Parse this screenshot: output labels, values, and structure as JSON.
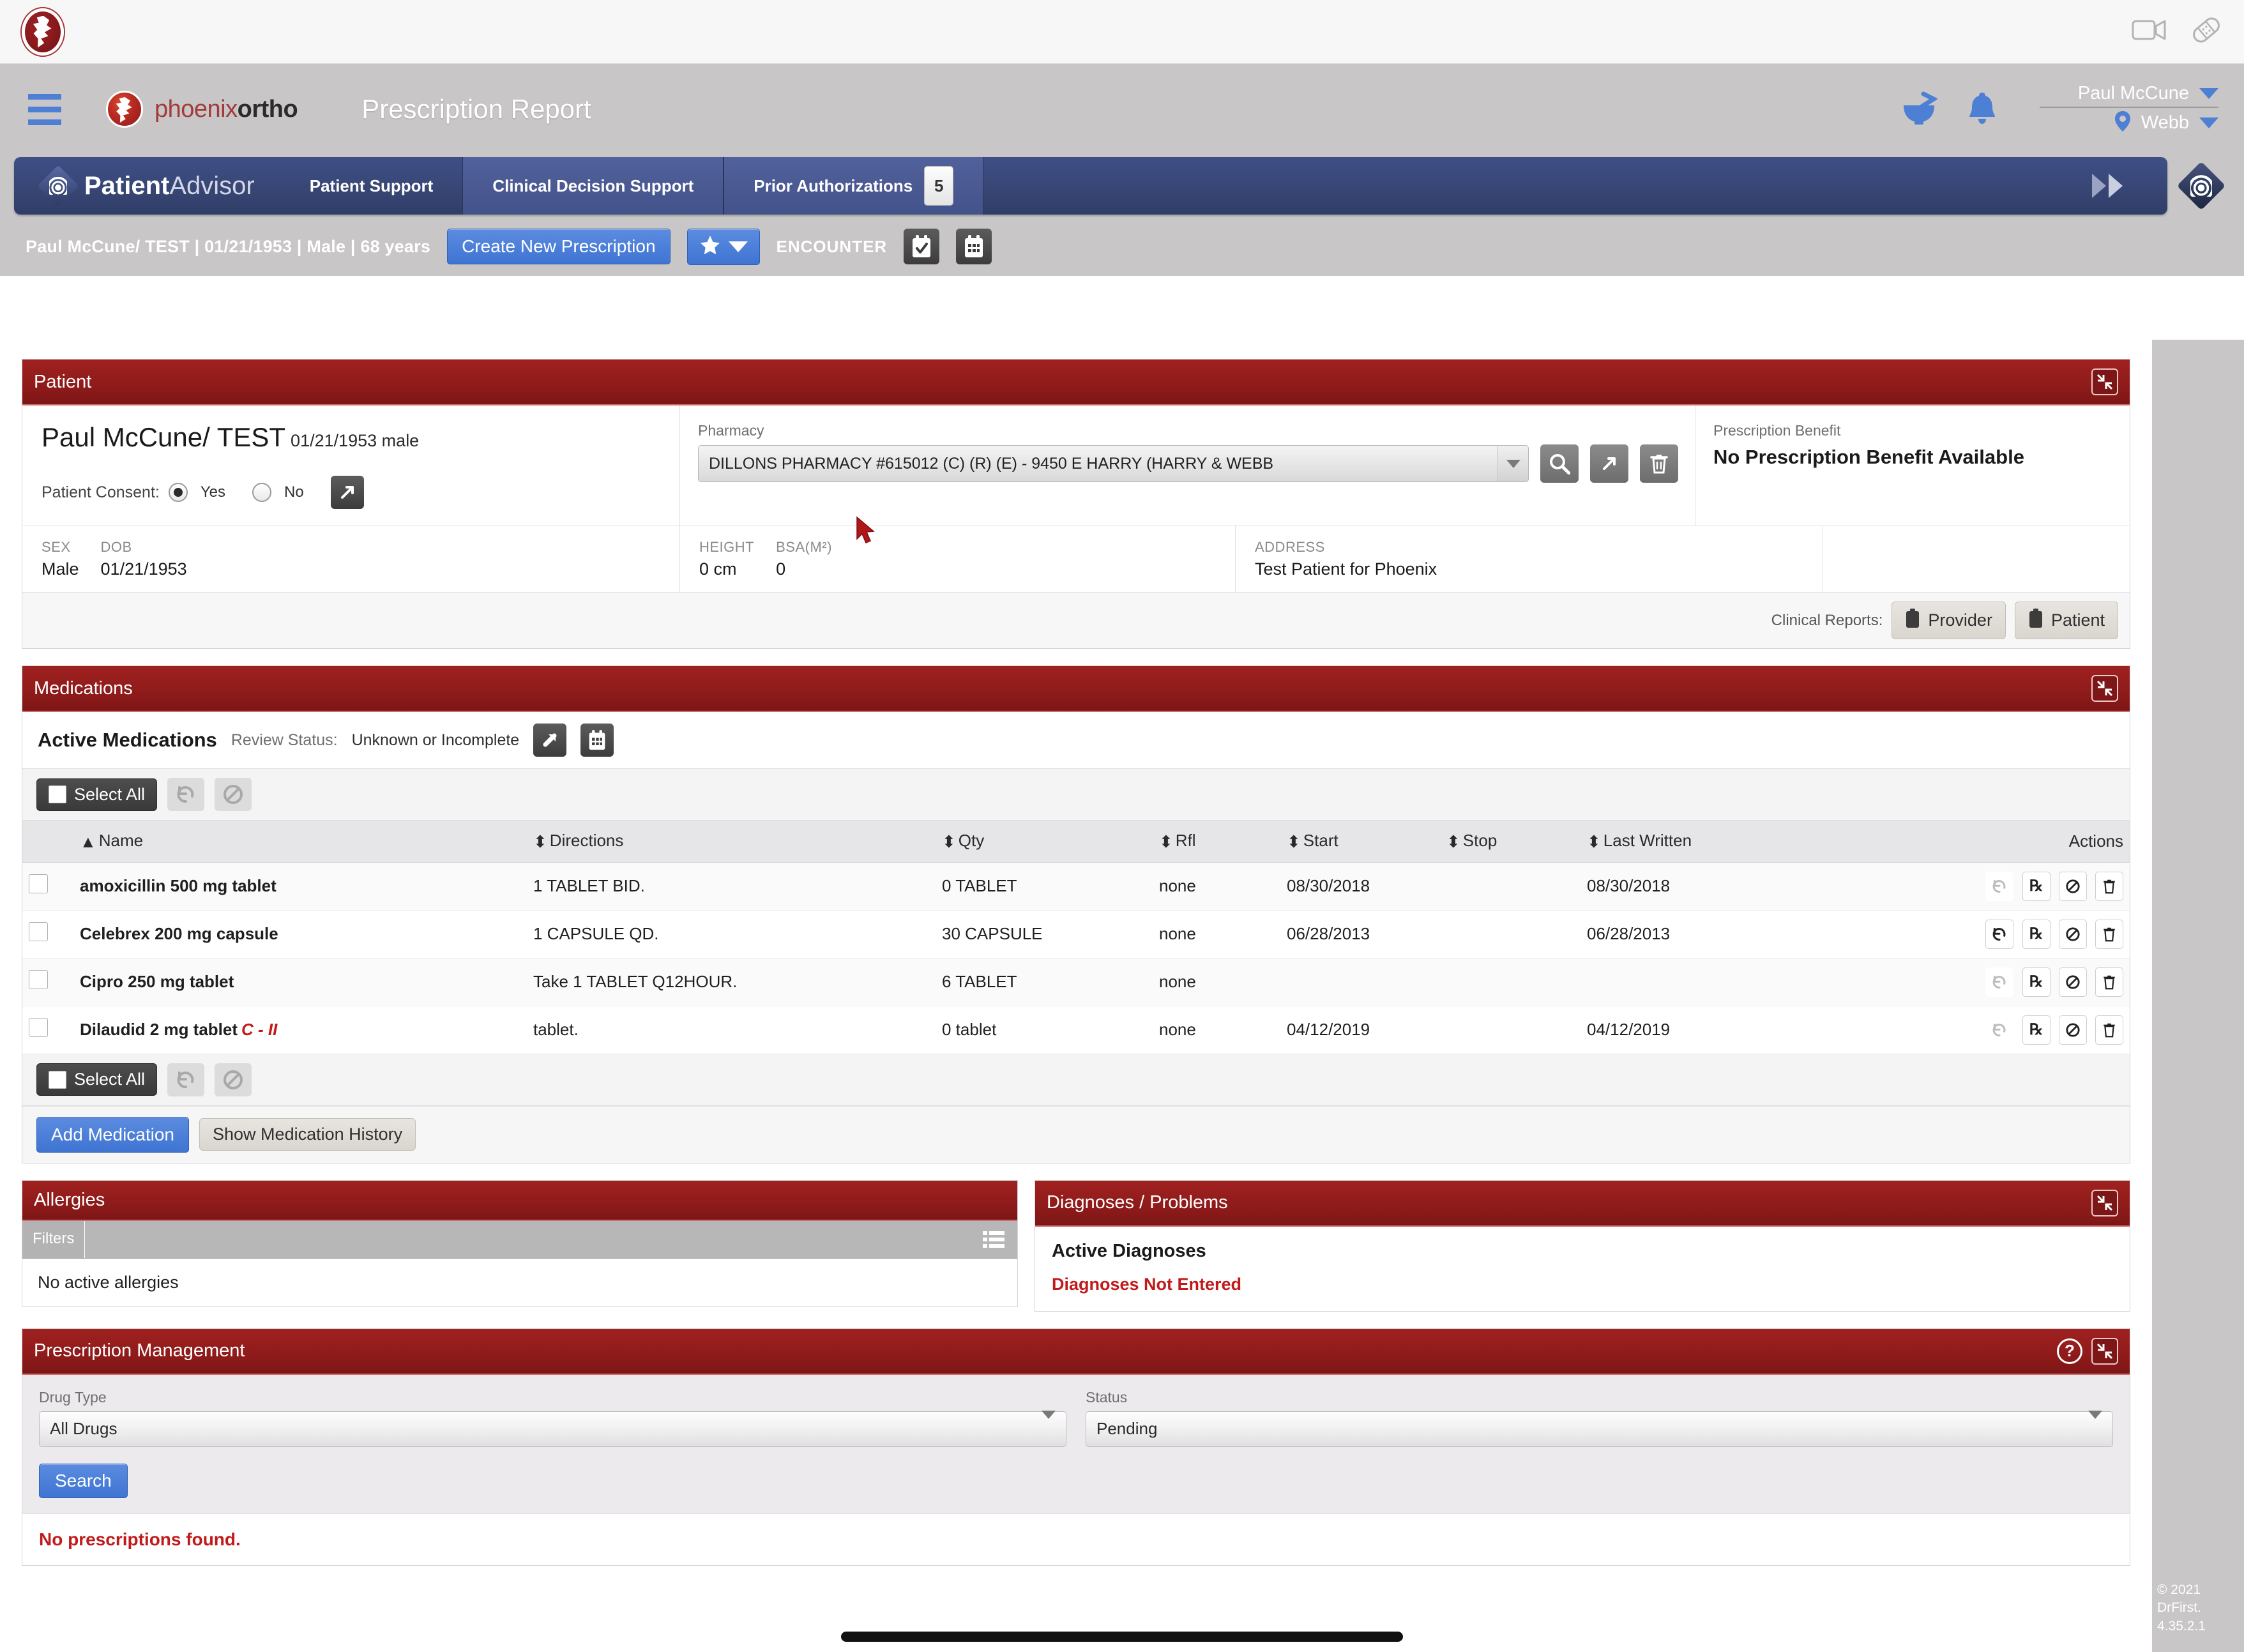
{
  "os_bar": {
    "icons": [
      "video-camera-icon",
      "bandage-icon"
    ]
  },
  "app_header": {
    "menu_icon": "hamburger-menu-icon",
    "brand_part1": "phoenix",
    "brand_part2": "ortho",
    "page_title": "Prescription Report",
    "pharmacy_icon": "mortar-pestle-icon",
    "bell_icon": "bell-icon",
    "user_name": "Paul McCune",
    "location_name": "Webb"
  },
  "patient_advisor": {
    "title_bold": "Patient",
    "title_light": "Advisor",
    "tabs": [
      {
        "label": "Patient Support",
        "active": false,
        "badge": ""
      },
      {
        "label": "Clinical Decision Support",
        "active": true,
        "badge": ""
      },
      {
        "label": "Prior Authorizations",
        "active": true,
        "badge": "5"
      }
    ],
    "forward_icon": "double-chevron-right-icon"
  },
  "context_strip": {
    "patient_summary": "Paul McCune/ TEST | 01/21/1953 | Male | 68 years",
    "create_prescription_label": "Create New Prescription",
    "favorites_icon": "star-icon",
    "encounter_label": "ENCOUNTER",
    "encounter_icons": [
      "calendar-check-icon",
      "calendar-grid-icon"
    ]
  },
  "patient_panel": {
    "title": "Patient",
    "collapse_icon": "collapse-icon",
    "name": "Paul McCune/ TEST",
    "name_sub": "01/21/1953 male",
    "consent_label": "Patient Consent:",
    "consent_yes": "Yes",
    "consent_no": "No",
    "consent_selected": "Yes",
    "consent_external_icon": "external-link-icon",
    "pharmacy_label": "Pharmacy",
    "pharmacy_value": "DILLONS PHARMACY #615012 (C) (R) (E) - 9450 E HARRY (HARRY & WEBB",
    "pharmacy_search_icon": "search-icon",
    "pharmacy_open_icon": "external-link-icon",
    "pharmacy_delete_icon": "trash-icon",
    "benefit_label": "Prescription Benefit",
    "benefit_value": "No Prescription Benefit Available",
    "demographics": [
      {
        "key": "SEX",
        "value": "Male"
      },
      {
        "key": "DOB",
        "value": "01/21/1953"
      },
      {
        "key": "HEIGHT",
        "value": "0 cm"
      },
      {
        "key": "BSA(M²)",
        "value": "0"
      },
      {
        "key": "ADDRESS",
        "value": "Test Patient for Phoenix"
      }
    ],
    "clinical_reports_label": "Clinical Reports:",
    "report_provider_label": "Provider",
    "report_patient_label": "Patient",
    "report_icon": "clipboard-icon"
  },
  "medications_panel": {
    "title": "Medications",
    "collapse_icon": "collapse-icon",
    "subtitle": "Active Medications",
    "review_status_label": "Review Status:",
    "review_status_value": "Unknown or Incomplete",
    "review_icons": [
      "pin-icon",
      "calendar-grid-icon"
    ],
    "select_all_label": "Select All",
    "toolbar_icons": [
      "undo-icon",
      "no-entry-icon"
    ],
    "columns": [
      "Name",
      "Directions",
      "Qty",
      "Rfl",
      "Start",
      "Stop",
      "Last Written",
      "Actions"
    ],
    "rows": [
      {
        "name": "amoxicillin 500 mg tablet",
        "schedule": "",
        "directions": "1 TABLET BID.",
        "qty": "0 TABLET",
        "rfl": "none",
        "start": "08/30/2018",
        "stop": "",
        "last_written": "08/30/2018"
      },
      {
        "name": "Celebrex 200 mg capsule",
        "schedule": "",
        "directions": "1 CAPSULE QD.",
        "qty": "30 CAPSULE",
        "rfl": "none",
        "start": "06/28/2013",
        "stop": "",
        "last_written": "06/28/2013"
      },
      {
        "name": "Cipro 250 mg tablet",
        "schedule": "",
        "directions": "Take 1 TABLET Q12HOUR.",
        "qty": "6 TABLET",
        "rfl": "none",
        "start": "",
        "stop": "",
        "last_written": ""
      },
      {
        "name": "Dilaudid 2 mg tablet",
        "schedule": "C - II",
        "directions": "tablet.",
        "qty": "0 tablet",
        "rfl": "none",
        "start": "04/12/2019",
        "stop": "",
        "last_written": "04/12/2019"
      }
    ],
    "row_action_icons": [
      "renew-icon",
      "rx-icon",
      "no-entry-icon",
      "trash-icon"
    ],
    "add_medication_label": "Add Medication",
    "show_history_label": "Show Medication History"
  },
  "allergies_panel": {
    "title": "Allergies",
    "filters_label": "Filters",
    "filters_icon": "list-icon",
    "empty_message": "No active allergies"
  },
  "diagnoses_panel": {
    "title": "Diagnoses / Problems",
    "collapse_icon": "collapse-icon",
    "heading": "Active Diagnoses",
    "warning": "Diagnoses Not Entered"
  },
  "prescription_management": {
    "title": "Prescription Management",
    "help_icon": "help-icon",
    "collapse_icon": "collapse-icon",
    "drug_type_label": "Drug Type",
    "drug_type_value": "All Drugs",
    "status_label": "Status",
    "status_value": "Pending",
    "search_label": "Search",
    "no_results": "No prescriptions found."
  },
  "footer": {
    "copyright_line1": "© 2021",
    "copyright_line2": "DrFirst.",
    "version": "4.35.2.1"
  },
  "colors": {
    "panel_header_red": "#8e1b1a",
    "accent_blue": "#3f74d2",
    "nav_navy": "#384675",
    "chrome_gray": "#c8c6c6",
    "alert_red": "#c01a1a"
  }
}
